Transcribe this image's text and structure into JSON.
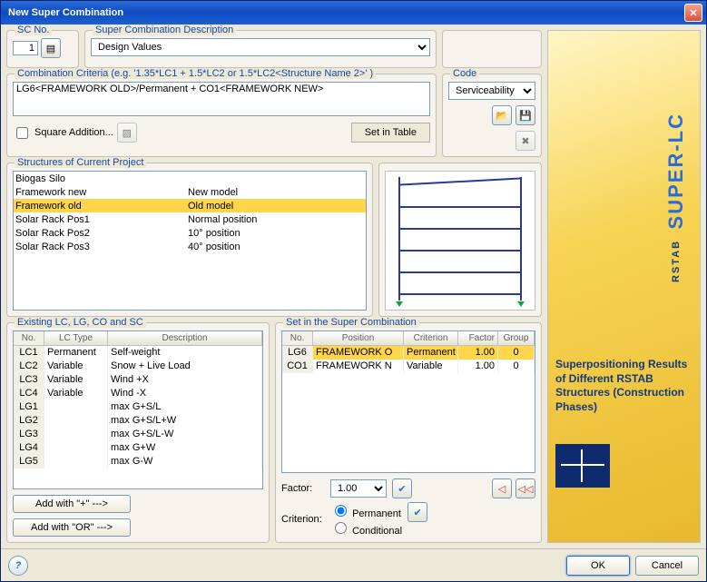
{
  "window": {
    "title": "New Super Combination"
  },
  "sc": {
    "label": "SC No.",
    "value": "1"
  },
  "desc": {
    "label": "Super Combination Description",
    "value": "Design Values"
  },
  "criteria": {
    "label": "Combination Criteria (e.g. '1.35*LC1 + 1.5*LC2 or 1.5*LC2<Structure Name 2>' )",
    "text": "LG6<FRAMEWORK OLD>/Permanent + CO1<FRAMEWORK NEW>",
    "square": "Square Addition...",
    "set_btn": "Set in Table"
  },
  "code": {
    "label": "Code",
    "value": "Serviceability"
  },
  "structures": {
    "label": "Structures of Current Project",
    "rows": [
      {
        "name": "Biogas Silo",
        "note": ""
      },
      {
        "name": "Framework new",
        "note": "New model"
      },
      {
        "name": "Framework old",
        "note": "Old model",
        "sel": true
      },
      {
        "name": "Solar Rack Pos1",
        "note": "Normal position"
      },
      {
        "name": "Solar Rack Pos2",
        "note": "10° position"
      },
      {
        "name": "Solar Rack Pos3",
        "note": "40° position"
      }
    ]
  },
  "existing": {
    "label": "Existing LC, LG, CO and SC",
    "headers": {
      "no": "No.",
      "type": "LC Type",
      "desc": "Description"
    },
    "rows": [
      {
        "no": "LC1",
        "type": "Permanent",
        "desc": "Self-weight"
      },
      {
        "no": "LC2",
        "type": "Variable",
        "desc": "Snow + Live Load"
      },
      {
        "no": "LC3",
        "type": "Variable",
        "desc": "Wind +X"
      },
      {
        "no": "LC4",
        "type": "Variable",
        "desc": "Wind -X"
      },
      {
        "no": "LG1",
        "type": "",
        "desc": "max G+S/L"
      },
      {
        "no": "LG2",
        "type": "",
        "desc": "max G+S/L+W"
      },
      {
        "no": "LG3",
        "type": "",
        "desc": "max G+S/L-W"
      },
      {
        "no": "LG4",
        "type": "",
        "desc": "max G+W"
      },
      {
        "no": "LG5",
        "type": "",
        "desc": "max G-W"
      }
    ],
    "add_plus": "Add with  \"+\" --->",
    "add_or": "Add with  \"OR\" --->"
  },
  "set": {
    "label": "Set in the Super Combination",
    "headers": {
      "no": "No.",
      "pos": "Position",
      "crit": "Criterion",
      "fac": "Factor",
      "grp": "Group"
    },
    "rows": [
      {
        "no": "LG6",
        "pos": "FRAMEWORK O",
        "crit": "Permanent",
        "fac": "1.00",
        "grp": "0",
        "sel": true
      },
      {
        "no": "CO1",
        "pos": "FRAMEWORK N",
        "crit": "Variable",
        "fac": "1.00",
        "grp": "0"
      }
    ],
    "factor_label": "Factor:",
    "factor_value": "1.00",
    "criterion_label": "Criterion:",
    "permanent": "Permanent",
    "conditional": "Conditional"
  },
  "banner": {
    "title1": "RSTAB",
    "title2": "SUPER-LC",
    "text": "Superpositioning Results of Different RSTAB Structures (Construction Phases)"
  },
  "footer": {
    "ok": "OK",
    "cancel": "Cancel"
  }
}
